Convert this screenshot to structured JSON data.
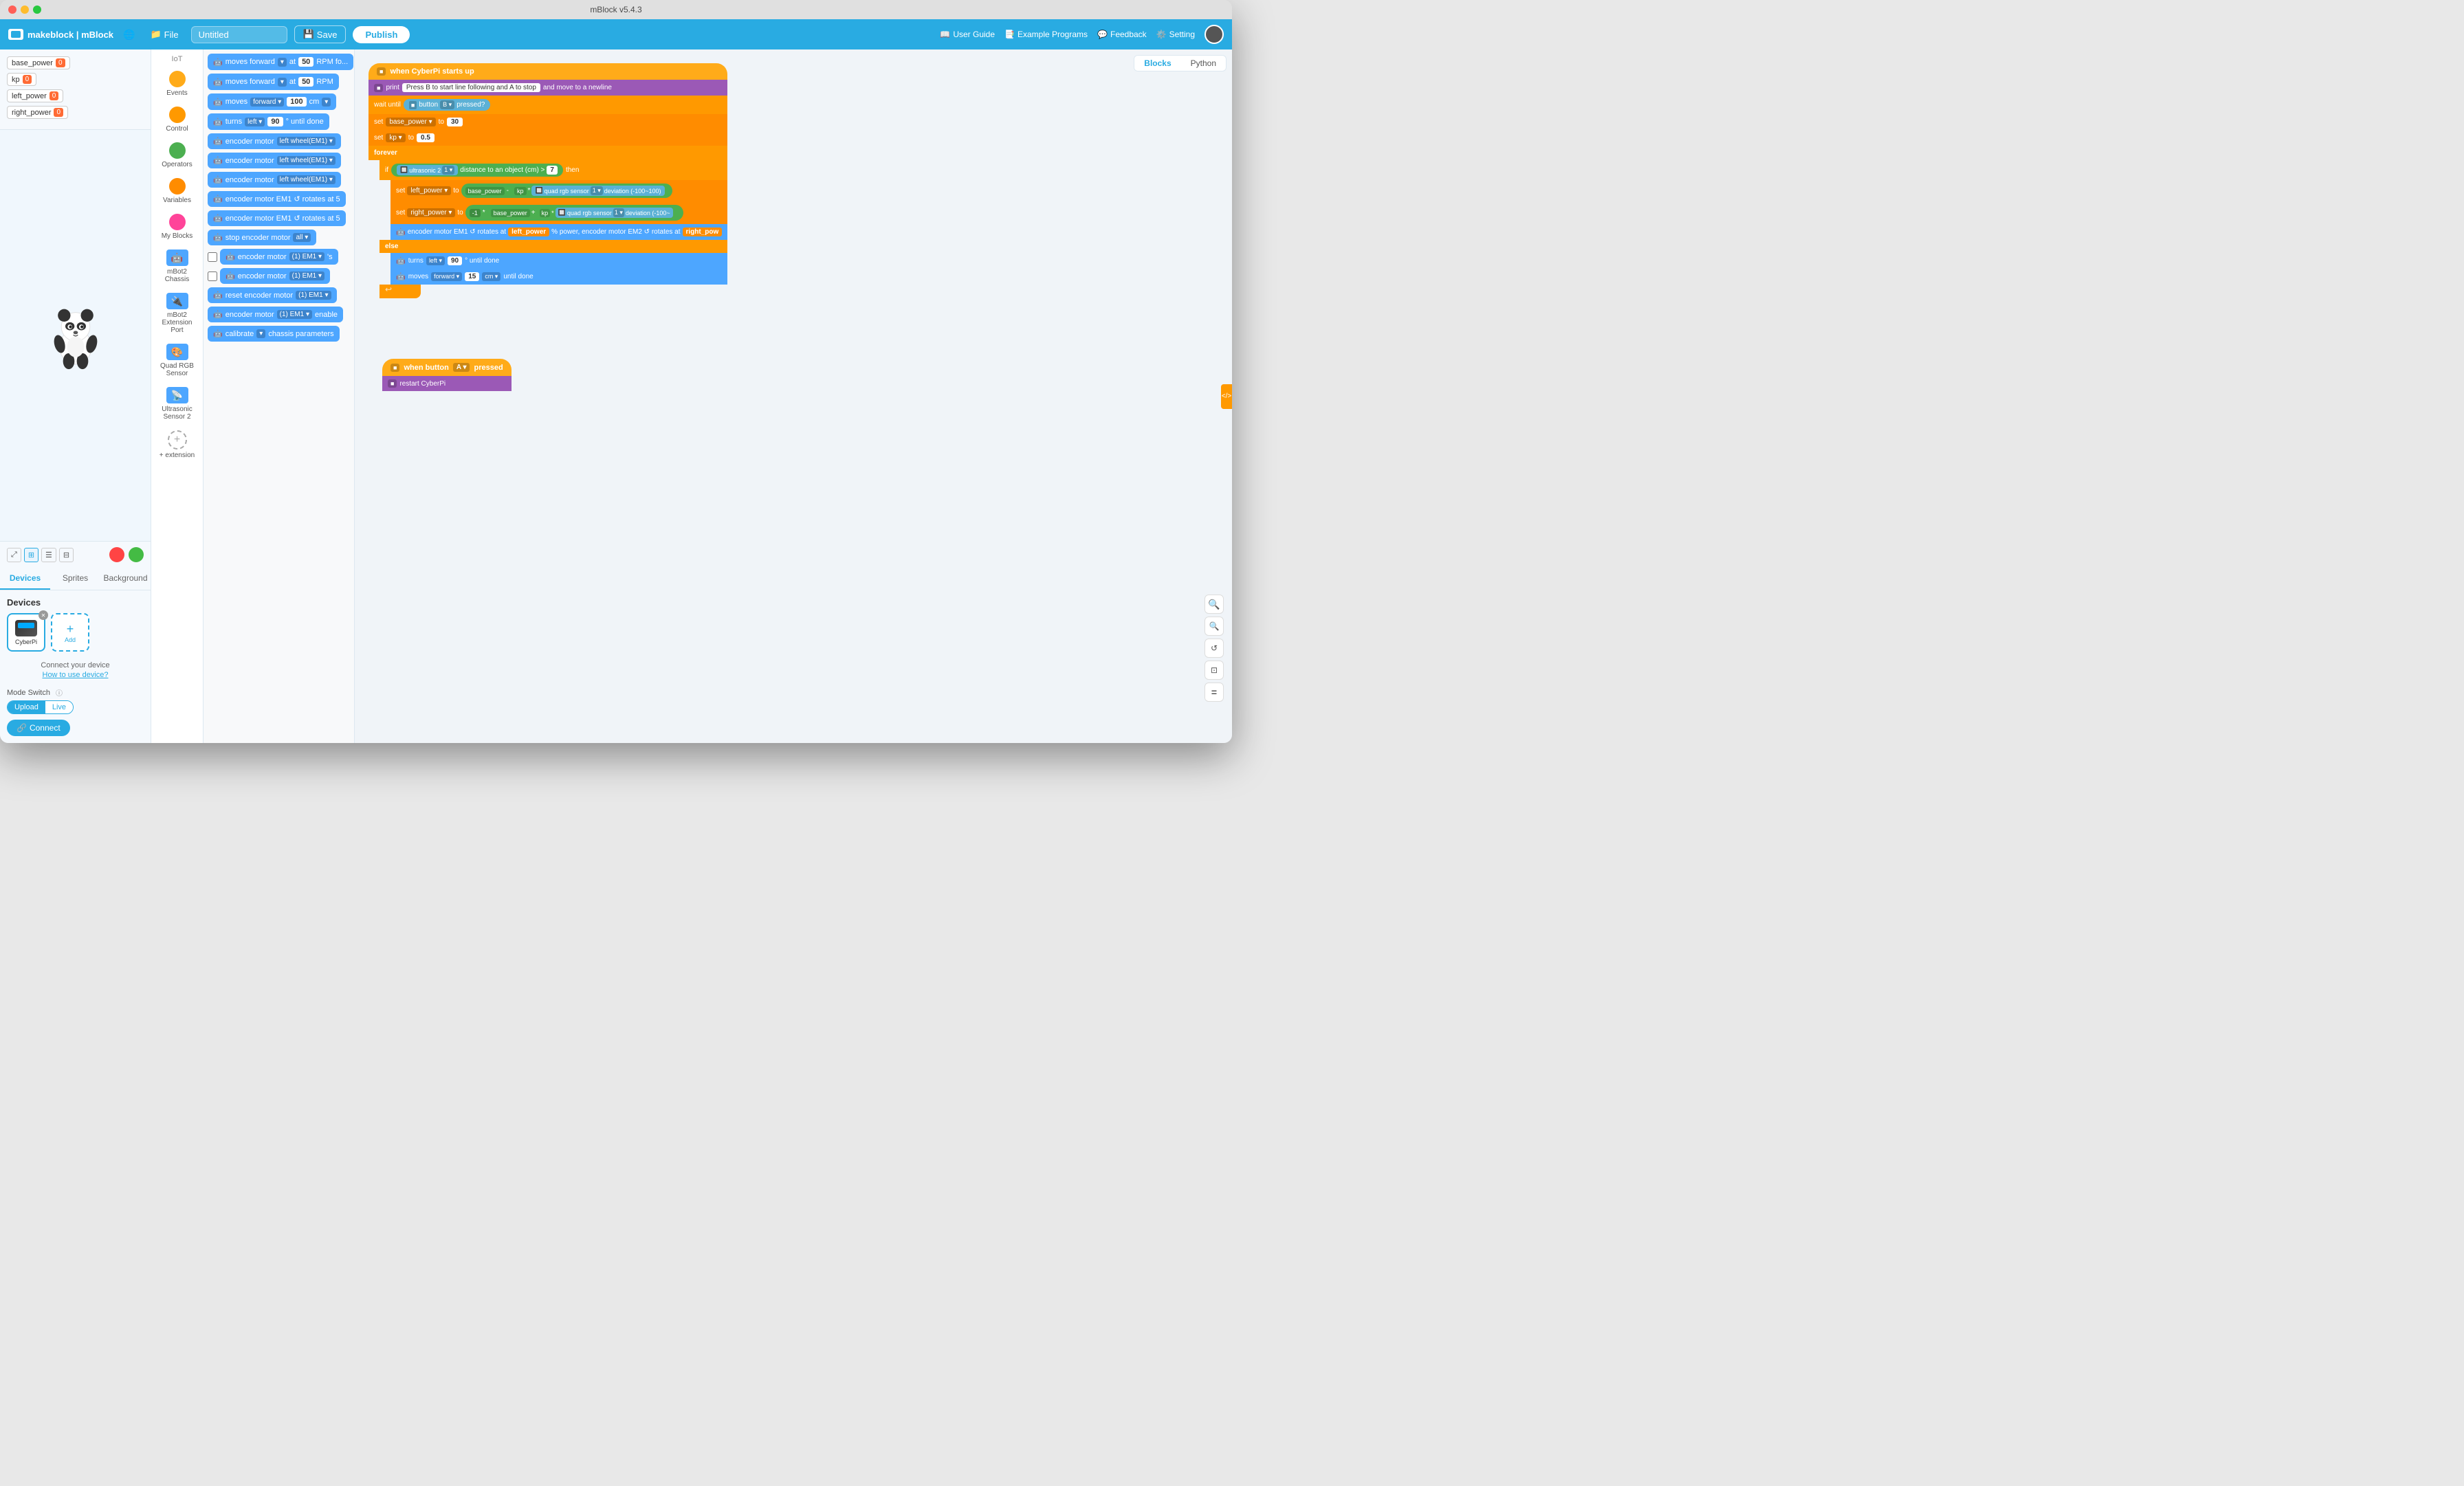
{
  "window": {
    "title": "mBlock v5.4.3"
  },
  "toolbar": {
    "brand": "makeblock | mBlock",
    "file_label": "File",
    "project_name": "Untitled",
    "save_label": "Save",
    "publish_label": "Publish",
    "user_guide": "User Guide",
    "example_programs": "Example Programs",
    "feedback": "Feedback",
    "setting": "Setting"
  },
  "tabs": {
    "blocks_label": "Blocks",
    "python_label": "Python"
  },
  "variables": [
    {
      "name": "base_power",
      "value": "0"
    },
    {
      "name": "kp",
      "value": "0"
    },
    {
      "name": "left_power",
      "value": "0"
    },
    {
      "name": "right_power",
      "value": "0"
    }
  ],
  "categories": [
    {
      "id": "iot",
      "label": "IoT",
      "color": "#888"
    },
    {
      "id": "events",
      "label": "Events",
      "color": "#ffab19"
    },
    {
      "id": "control",
      "label": "Control",
      "color": "#ff9900"
    },
    {
      "id": "operators",
      "label": "Operators",
      "color": "#4CAF50"
    },
    {
      "id": "variables",
      "label": "Variables",
      "color": "#ff8c00"
    },
    {
      "id": "myblocks",
      "label": "My Blocks",
      "color": "#ff4499"
    },
    {
      "id": "mbot2chassis",
      "label": "mBot2 Chassis",
      "color": "#4da6ff"
    },
    {
      "id": "mbot2ext",
      "label": "mBot2 Extension Port",
      "color": "#4da6ff"
    },
    {
      "id": "quadrgb",
      "label": "Quad RGB Sensor",
      "color": "#4da6ff"
    },
    {
      "id": "ultrasonic2",
      "label": "Ultrasonic Sensor 2",
      "color": "#4da6ff"
    },
    {
      "id": "extension",
      "label": "+ extension",
      "color": "#888"
    }
  ],
  "blocks_panel": [
    {
      "type": "motion",
      "text": "moves forward ▾ at 50 RPM fo..."
    },
    {
      "type": "motion",
      "text": "moves forward ▾ at 50 RPM"
    },
    {
      "type": "motion",
      "text": "moves forward ▾ 100 cm ▾"
    },
    {
      "type": "motion",
      "text": "turns left ▾ 90 ° until done"
    },
    {
      "type": "motion",
      "text": "encoder motor left wheel(EM1) ▾"
    },
    {
      "type": "motion",
      "text": "encoder motor left wheel(EM1) ▾"
    },
    {
      "type": "motion",
      "text": "encoder motor left wheel(EM1) ▾"
    },
    {
      "type": "motion",
      "text": "encoder motor EM1 ↺ rotates at 5"
    },
    {
      "type": "motion",
      "text": "encoder motor EM1 ↺ rotates at 5"
    },
    {
      "type": "motion",
      "text": "stop encoder motor all ▾"
    },
    {
      "type": "check",
      "text": "encoder motor (1) EM1 ▾ 's"
    },
    {
      "type": "check",
      "text": "encoder motor (1) EM1 ▾"
    },
    {
      "type": "motion",
      "text": "reset encoder motor (1) EM1 ▾"
    },
    {
      "type": "motion",
      "text": "encoder motor (1) EM1 ▾ enable"
    },
    {
      "type": "motion",
      "text": "calibrate ▾ chassis parameters"
    }
  ],
  "panel_tabs": {
    "devices": "Devices",
    "sprites": "Sprites",
    "background": "Background"
  },
  "devices": {
    "label": "Devices",
    "items": [
      {
        "name": "CyberPi",
        "type": "cyberpi"
      }
    ],
    "add_label": "Add",
    "connect_hint": "Connect your device",
    "how_to": "How to use device?",
    "mode_switch": "Mode Switch",
    "upload_label": "Upload",
    "live_label": "Live",
    "connect_label": "Connect"
  },
  "canvas": {
    "stack1": {
      "hat": "when CyberPi starts up",
      "blocks": [
        "print  Press B to start line following and A to stop  and move to a newline",
        "wait until  ■ button B ▾ pressed?",
        "set base_power ▾ to 30",
        "set kp ▾ to 0.5",
        "forever",
        "if  🔲 ultrasonic 2  1 ▾  distance to an object (cm)  >  7  then",
        "set left_power ▾ to  base_power  -  kp  *  🔲 quad rgb sensor  1 ▾  deviation (-100~100)",
        "set right_power ▾ to  -1  *  base_power  +  kp  *  🔲 quad rgb sensor  1 ▾  deviation (-100~",
        "encoder motor EM1 ↺ rotates at  left_power  % power, encoder motor EM2 ↺ rotates at  right_pow",
        "else",
        "turns left ▾  90  ° until done",
        "moves forward ▾  15  cm ▾ until done"
      ]
    },
    "stack2": {
      "hat": "when button A ▾ pressed",
      "blocks": [
        "restart CyberPi"
      ]
    }
  },
  "zoom_controls": {
    "zoom_in": "+",
    "zoom_out": "-",
    "reset": "↺",
    "fit": "⊡",
    "equals": "="
  }
}
